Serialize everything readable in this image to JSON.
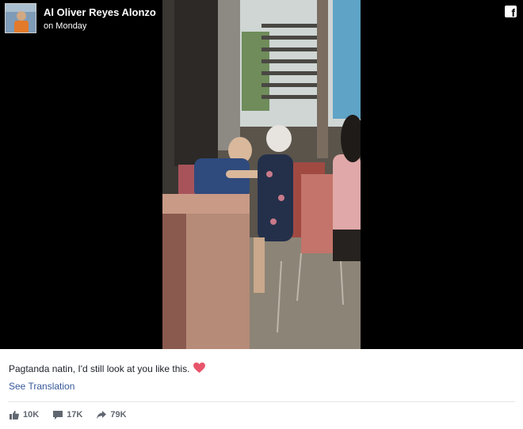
{
  "post": {
    "author": "Al Oliver Reyes Alonzo",
    "time": "on Monday",
    "caption": "Pagtanda natin, I'd still look at you like this.",
    "see_translation": "See Translation"
  },
  "icons": {
    "header_logo": "facebook-icon",
    "caption_emoji": "heart-icon",
    "like": "thumbs-up-icon",
    "comment": "comment-icon",
    "share": "share-arrow-icon"
  },
  "stats": {
    "likes": "10K",
    "comments": "17K",
    "shares": "79K"
  },
  "colors": {
    "link": "#365899",
    "heart": "#e8556b",
    "stat_gray": "#616770"
  }
}
